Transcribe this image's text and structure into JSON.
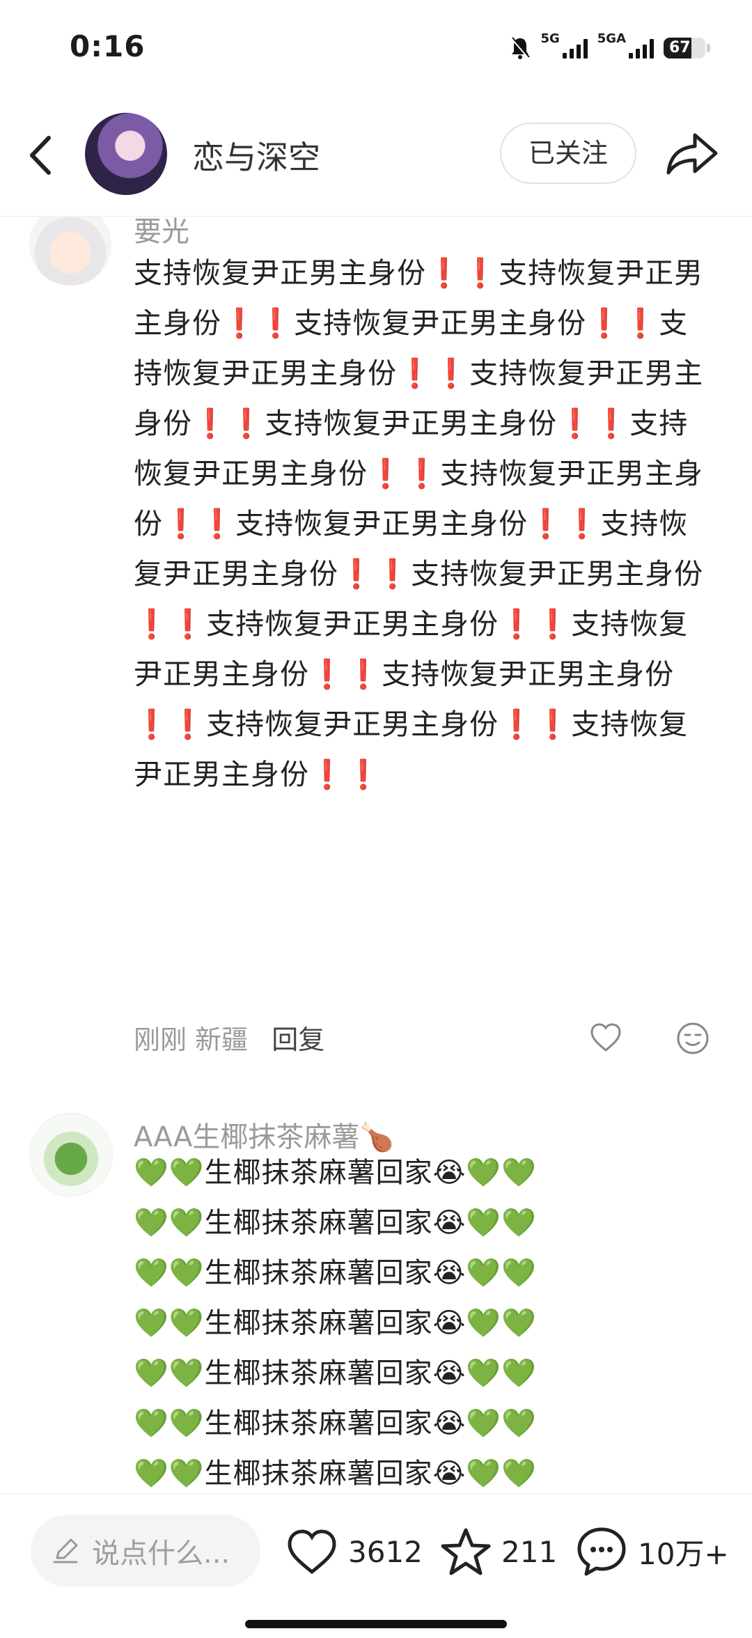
{
  "status_bar": {
    "time": "0:16",
    "network_1": "5G",
    "network_2": "5GA",
    "battery": "67"
  },
  "header": {
    "title": "恋与深空",
    "follow_label": "已关注"
  },
  "comments": [
    {
      "author": "要光",
      "text": "支持恢复尹正男主身份❗️❗️支持恢复尹正男主身份❗️❗️支持恢复尹正男主身份❗️❗️支持恢复尹正男主身份❗️❗️支持恢复尹正男主身份❗️❗️支持恢复尹正男主身份❗️❗️支持恢复尹正男主身份❗️❗️支持恢复尹正男主身份❗️❗️支持恢复尹正男主身份❗️❗️支持恢复尹正男主身份❗️❗️支持恢复尹正男主身份❗️❗️支持恢复尹正男主身份❗️❗️支持恢复尹正男主身份❗️❗️支持恢复尹正男主身份❗️❗️支持恢复尹正男主身份❗️❗️支持恢复尹正男主身份❗️❗️",
      "time": "刚刚",
      "location": "新疆",
      "reply_label": "回复"
    },
    {
      "author": "AAA生椰抹茶麻薯🍗",
      "lines": [
        "💚💚生椰抹茶麻薯回家😭💚💚",
        "💚💚生椰抹茶麻薯回家😭💚💚",
        "💚💚生椰抹茶麻薯回家😭💚💚",
        "💚💚生椰抹茶麻薯回家😭💚💚",
        "💚💚生椰抹茶麻薯回家😭💚💚",
        "💚💚生椰抹茶麻薯回家😭💚💚",
        "💚💚生椰抹茶麻薯回家😭💚💚"
      ]
    }
  ],
  "bottom_bar": {
    "input_placeholder": "说点什么...",
    "likes": "3612",
    "favorites": "211",
    "comments": "10万+"
  },
  "icons": {
    "back": "chevron-left-icon",
    "share": "share-arrow-icon",
    "like": "heart-outline-icon",
    "emoji": "emoji-face-icon",
    "pen": "pen-icon",
    "star": "star-outline-icon",
    "chat": "chat-bubble-icon"
  }
}
